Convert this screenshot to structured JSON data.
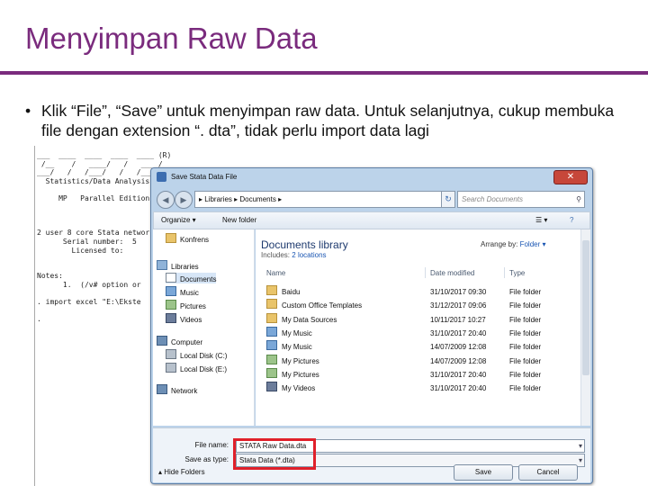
{
  "slide": {
    "title": "Menyimpan Raw Data",
    "bullet_symbol": "•",
    "bullet": "Klik “File”, “Save” untuk menyimpan raw data. Untuk selanjutnya, cukup membuka file dengan extension “. dta”, tidak perlu import data lagi"
  },
  "stata_bg": {
    "lines": [
      "___  ____  ____  ____  ____ (R)",
      " /__    /   ____/   /   ____/",
      "___/   /   /___/   /   /___/",
      "  Statistics/Data Analysis",
      "",
      "     MP   Parallel Edition",
      "",
      "",
      "",
      "2 user 8 core Stata network",
      "      Serial number:  5",
      "        Licensed to:  ",
      "",
      "",
      "Notes:",
      "      1.  (/v# option or",
      "",
      ". import excel \"E:\\Ekste",
      "",
      "."
    ]
  },
  "dialog": {
    "title": "Save Stata Data File",
    "close_symbol": "✕",
    "back_symbol": "◀",
    "forward_symbol": "▶",
    "refresh_symbol": "↻",
    "breadcrumb": "▸ Libraries ▸ Documents ▸",
    "search_placeholder": "Search Documents",
    "search_icon": "⚲",
    "toolbar": {
      "organize": "Organize ▾",
      "new_folder": "New folder",
      "view_symbol": "☰ ▾",
      "help_symbol": "?"
    },
    "nav_items": [
      {
        "label": "Konfrens",
        "icon": "folder"
      },
      {
        "label": "Libraries",
        "icon": "lib"
      },
      {
        "label": "Documents",
        "icon": "doc"
      },
      {
        "label": "Music",
        "icon": "note"
      },
      {
        "label": "Pictures",
        "icon": "pic"
      },
      {
        "label": "Videos",
        "icon": "vid"
      },
      {
        "label": "Computer",
        "icon": "pc"
      },
      {
        "label": "Local Disk (C:)",
        "icon": "disk"
      },
      {
        "label": "Local Disk (E:)",
        "icon": "disk"
      },
      {
        "label": "Network",
        "icon": "pc"
      }
    ],
    "library": {
      "title": "Documents library",
      "includes_label": "Includes:",
      "includes_link": "2 locations",
      "arrange_label": "Arrange by:",
      "arrange_value": "Folder ▾"
    },
    "columns": [
      "Name",
      "Date modified",
      "Type"
    ],
    "files": [
      {
        "name": "Baidu",
        "date": "31/10/2017 09:30",
        "type": "File folder",
        "icon": "folder"
      },
      {
        "name": "Custom Office Templates",
        "date": "31/12/2017 09:06",
        "type": "File folder",
        "icon": "folder"
      },
      {
        "name": "My Data Sources",
        "date": "10/11/2017 10:27",
        "type": "File folder",
        "icon": "folder"
      },
      {
        "name": "My Music",
        "date": "31/10/2017 20:40",
        "type": "File folder",
        "icon": "note"
      },
      {
        "name": "My Music",
        "date": "14/07/2009 12:08",
        "type": "File folder",
        "icon": "note"
      },
      {
        "name": "My Pictures",
        "date": "14/07/2009 12:08",
        "type": "File folder",
        "icon": "pic"
      },
      {
        "name": "My Pictures",
        "date": "31/10/2017 20:40",
        "type": "File folder",
        "icon": "pic"
      },
      {
        "name": "My Videos",
        "date": "31/10/2017 20:40",
        "type": "File folder",
        "icon": "vid"
      }
    ],
    "file_name_label": "File name:",
    "file_name_value": "STATA Raw Data.dta",
    "save_type_label": "Save as type:",
    "save_type_value": "Stata Data (*.dta)",
    "dropdown_symbol": "▾",
    "hide_folders": "▴ Hide Folders",
    "save_button": "Save",
    "cancel_button": "Cancel"
  },
  "colors": {
    "title": "#7a2b7d",
    "highlight": "#e0202a",
    "dialog_frame": "#bcd3ea"
  }
}
